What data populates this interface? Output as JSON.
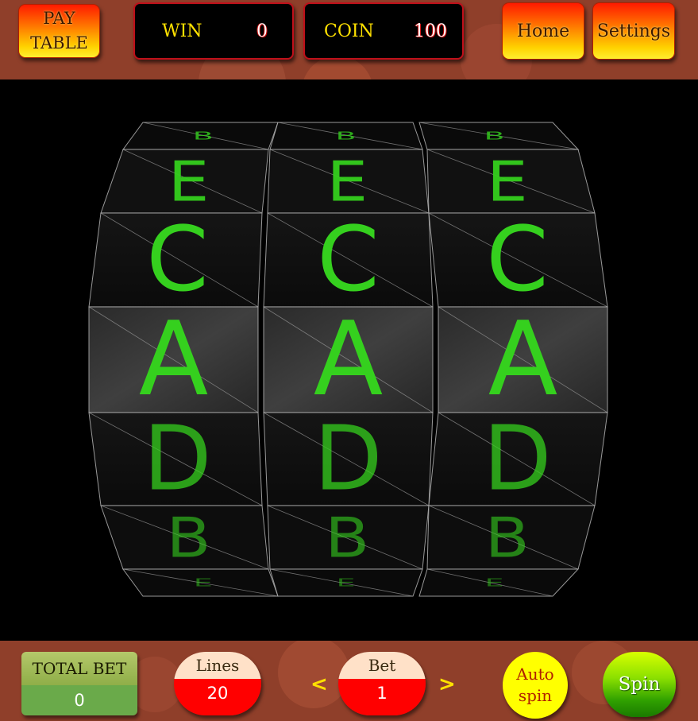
{
  "header": {
    "paytable_line1": "PAY",
    "paytable_line2": "TABLE",
    "win_label": "WIN",
    "win_value": "0",
    "coin_label": "COIN",
    "coin_value": "100",
    "home_label": "Home",
    "settings_label": "Settings"
  },
  "reels": {
    "symbol_color": "#35d01e",
    "columns": [
      [
        "B",
        "E",
        "C",
        "A",
        "D",
        "B",
        "E"
      ],
      [
        "B",
        "E",
        "C",
        "A",
        "D",
        "B",
        "E"
      ],
      [
        "B",
        "E",
        "C",
        "A",
        "D",
        "B",
        "E"
      ]
    ]
  },
  "footer": {
    "total_bet_label": "TOTAL BET",
    "total_bet_value": "0",
    "lines_label": "Lines",
    "lines_value": "20",
    "bet_label": "Bet",
    "bet_value": "1",
    "prev_arrow": "<",
    "next_arrow": ">",
    "autospin_line1": "Auto",
    "autospin_line2": "spin",
    "spin_label": "Spin"
  },
  "colors": {
    "bar_background": "#8f3f2a",
    "accent_yellow": "#ffe100",
    "meter_border": "#c0101a"
  }
}
